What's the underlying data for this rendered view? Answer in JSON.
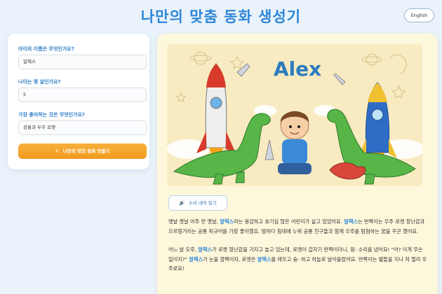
{
  "header": {
    "title": "나만의 맞춤 동화 생성기",
    "lang_button": "English"
  },
  "form": {
    "name_label": "아이의 이름은 무엇인가요?",
    "name_value": "알렉스",
    "age_label": "나이는 몇 살인가요?",
    "age_value": "5",
    "likes_label": "가장 좋아하는 것은 무엇인가요?",
    "likes_value": "공룡과 우주 로켓",
    "create_button": "나만의 멋진 동화 만들기",
    "create_icon": "magic-wand-icon"
  },
  "story": {
    "illustration_name": "Alex",
    "read_button": "소리 내어 읽기",
    "read_icon": "speaker-icon",
    "p1": {
      "a": "옛날 옛날 아주 먼 옛날, ",
      "name1": "알렉스",
      "b": "라는 용감하고 호기심 많은 어린이가 살고 있었어요. ",
      "name2": "알렉스",
      "c": "는 반짝이는 우주 로켓 장난감과 으르렁거리는 공룡 피규어를 가장 좋아했죠. 밤마다 침대에 누워 공룡 친구들과 함께 우주를 탐험하는 꿈을 꾸곤 했어요."
    },
    "p2": {
      "a": "어느 날 오후, ",
      "name1": "알렉스",
      "b": "가 로켓 장난감을 가지고 놀고 있는데, 로켓이 갑자기 반짝이더니, 윙- 소리를 냈어요! \"어? 이게 무슨 일이지?\" ",
      "name2": "알렉스",
      "c": "가 눈을 깜빡이자, 로켓은 ",
      "name3": "알렉스",
      "d": "를 태우고 슝- 하고 하늘로 날아올랐어요. 반짝이는 별들을 지나 저 멀리 우주로요!"
    }
  },
  "colors": {
    "accent": "#2f86d6",
    "button_orange": "#f29a1e",
    "card_bg": "#fdf7dc",
    "page_bg": "#eaf3fb"
  }
}
